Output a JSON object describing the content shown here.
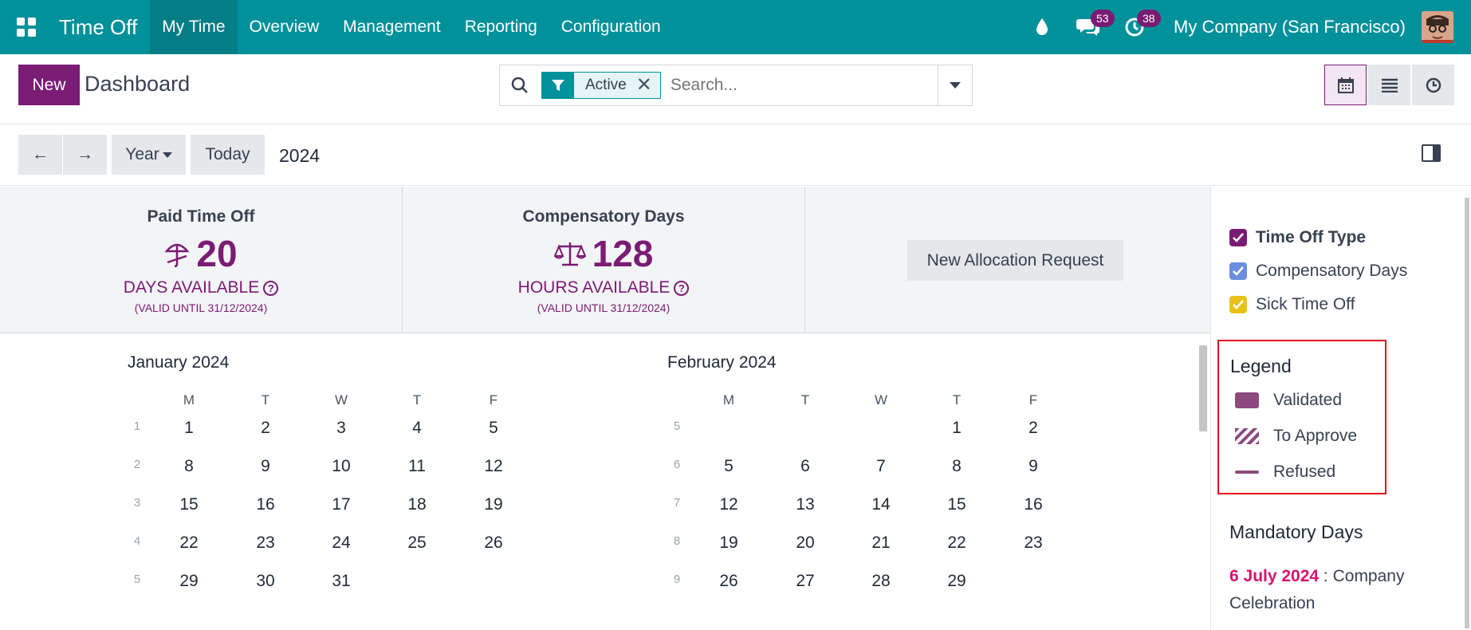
{
  "topnav": {
    "app_title": "Time Off",
    "menu": [
      "My Time",
      "Overview",
      "Management",
      "Reporting",
      "Configuration"
    ],
    "messages_count": "53",
    "activities_count": "38",
    "company": "My Company (San Francisco)",
    "accent": "#00919A"
  },
  "control": {
    "new_label": "New",
    "title": "Dashboard",
    "facet_label": "Active",
    "facet_close": "✕",
    "search_placeholder": "Search..."
  },
  "calbar": {
    "prev": "←",
    "next": "→",
    "range_label": "Year",
    "today_label": "Today",
    "year": "2024"
  },
  "summary": {
    "cards": [
      {
        "title": "Paid Time Off",
        "value": "20",
        "unit": "DAYS AVAILABLE",
        "valid": "(VALID UNTIL 31/12/2024)",
        "icon": "umbrella-icon"
      },
      {
        "title": "Compensatory Days",
        "value": "128",
        "unit": "HOURS AVAILABLE",
        "valid": "(VALID UNTIL 31/12/2024)",
        "icon": "balance-scale-icon"
      }
    ],
    "alloc_button": "New Allocation Request",
    "help_glyph": "?"
  },
  "calendar": {
    "dow": [
      "M",
      "T",
      "W",
      "T",
      "F"
    ],
    "months": [
      {
        "title": "January 2024",
        "weeks": [
          "1",
          "2",
          "3",
          "4",
          "5"
        ],
        "rows": [
          [
            "1",
            "2",
            "3",
            "4",
            "5"
          ],
          [
            "8",
            "9",
            "10",
            "11",
            "12"
          ],
          [
            "15",
            "16",
            "17",
            "18",
            "19"
          ],
          [
            "22",
            "23",
            "24",
            "25",
            "26"
          ],
          [
            "29",
            "30",
            "31",
            "",
            ""
          ]
        ]
      },
      {
        "title": "February 2024",
        "weeks": [
          "5",
          "6",
          "7",
          "8",
          "9"
        ],
        "rows": [
          [
            "",
            "",
            "",
            "1",
            "2"
          ],
          [
            "5",
            "6",
            "7",
            "8",
            "9"
          ],
          [
            "12",
            "13",
            "14",
            "15",
            "16"
          ],
          [
            "19",
            "20",
            "21",
            "22",
            "23"
          ],
          [
            "26",
            "27",
            "28",
            "29",
            ""
          ]
        ]
      }
    ]
  },
  "sidepanel": {
    "filters": [
      {
        "label": "Time Off Type",
        "color": "#7a1b74",
        "bold": true
      },
      {
        "label": "Compensatory Days",
        "color": "#6b8ee0",
        "bold": false
      },
      {
        "label": "Sick Time Off",
        "color": "#e8c21a",
        "bold": false
      }
    ],
    "legend_title": "Legend",
    "legend": [
      "Validated",
      "To Approve",
      "Refused"
    ],
    "mandatory_title": "Mandatory Days",
    "mandatory_date": "6 July 2024",
    "mandatory_text": " : Company Celebration"
  }
}
